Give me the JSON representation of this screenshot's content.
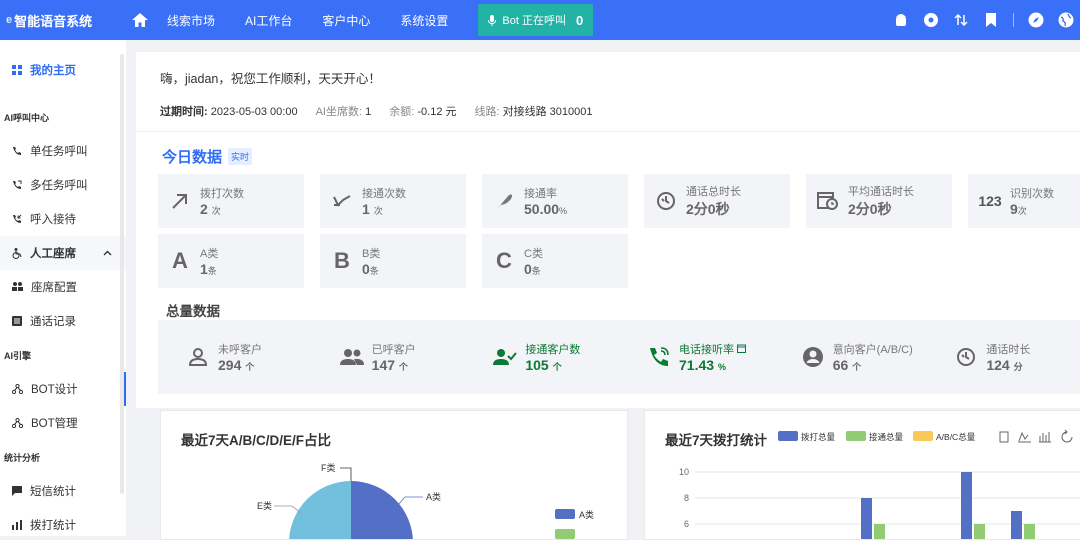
{
  "app": {
    "title": "智能语音系统",
    "logo": "e"
  },
  "nav": {
    "items": [
      "线索市场",
      "AI工作台",
      "客户中心",
      "系统设置"
    ]
  },
  "bot": {
    "label": "Bot 正在呼叫",
    "count": "0"
  },
  "sidebar": {
    "home": "我的主页",
    "sec1": "AI呼叫中心",
    "single": "单任务呼叫",
    "multi": "多任务呼叫",
    "inbound": "呼入接待",
    "human": "人工座席",
    "seat_config": "座席配置",
    "call_records": "通话记录",
    "sec2": "AI引擎",
    "bot_design": "BOT设计",
    "bot_manage": "BOT管理",
    "sec3": "统计分析",
    "sms": "短信统计",
    "dial": "拨打统计"
  },
  "welcome": {
    "greeting": "嗨，jiadan，祝您工作顺利，天天开心！",
    "expire_k": "过期时间:",
    "expire_v": "2023-05-03 00:00",
    "seats_k": "AI坐席数:",
    "seats_v": "1",
    "balance_k": "余额:",
    "balance_v": "-0.12 元",
    "line_k": "线路:",
    "line_v": "对接线路 3010001"
  },
  "today": {
    "title": "今日数据",
    "tag": "实时",
    "cards": [
      {
        "label": "拨打次数",
        "value": "2",
        "unit": "次",
        "icon": "arrow-up-right-icon"
      },
      {
        "label": "接通次数",
        "value": "1",
        "unit": "次",
        "icon": "arrow-down-left-icon"
      },
      {
        "label": "接通率",
        "value": "50.00",
        "unit": "%",
        "icon": "feather-icon"
      },
      {
        "label": "通话总时长",
        "value": "2分0秒",
        "unit": "",
        "icon": "timer-icon"
      },
      {
        "label": "平均通话时长",
        "value": "2分0秒",
        "unit": "",
        "icon": "calendar-clock-icon"
      },
      {
        "label": "识别次数",
        "value": "9",
        "unit": "次",
        "icon": "123-icon"
      },
      {
        "label": "A类",
        "value": "1",
        "unit": "条",
        "icon": "letter-a-icon",
        "letter": "A"
      },
      {
        "label": "B类",
        "value": "0",
        "unit": "条",
        "icon": "letter-b-icon",
        "letter": "B"
      },
      {
        "label": "C类",
        "value": "0",
        "unit": "条",
        "icon": "letter-c-icon",
        "letter": "C"
      }
    ]
  },
  "totals": {
    "title": "总量数据",
    "items": [
      {
        "label": "未呼客户",
        "value": "294",
        "unit": "个"
      },
      {
        "label": "已呼客户",
        "value": "147",
        "unit": "个"
      },
      {
        "label": "接通客户数",
        "value": "105",
        "unit": "个"
      },
      {
        "label": "电话接听率",
        "value": "71.43",
        "unit": "%"
      },
      {
        "label": "意向客户(A/B/C)",
        "value": "66",
        "unit": "个"
      },
      {
        "label": "通话时长",
        "value": "124",
        "unit": "分"
      }
    ]
  },
  "pie": {
    "title": "最近7天A/B/C/D/E/F占比",
    "labels": {
      "f": "F类",
      "e": "E类",
      "a": "A类"
    },
    "legend": [
      "A类"
    ]
  },
  "bar": {
    "title": "最近7天拨打统计",
    "legend": [
      "拨打总量",
      "接通总量",
      "A/B/C总量"
    ],
    "colors": {
      "dial": "#5470c6",
      "connect": "#91cc75",
      "abc": "#fac858"
    },
    "yticks": [
      "10",
      "8",
      "6"
    ]
  },
  "chart_data": [
    {
      "type": "pie",
      "title": "最近7天A/B/C/D/E/F占比",
      "categories": [
        "F类",
        "E类",
        "A类"
      ],
      "values": [
        null,
        null,
        null
      ]
    },
    {
      "type": "bar",
      "title": "最近7天拨打统计",
      "ylim": [
        6,
        10
      ],
      "series": [
        {
          "name": "拨打总量",
          "values": [
            8,
            10,
            7
          ]
        },
        {
          "name": "接通总量",
          "values": [
            6,
            6,
            6
          ]
        }
      ]
    }
  ]
}
